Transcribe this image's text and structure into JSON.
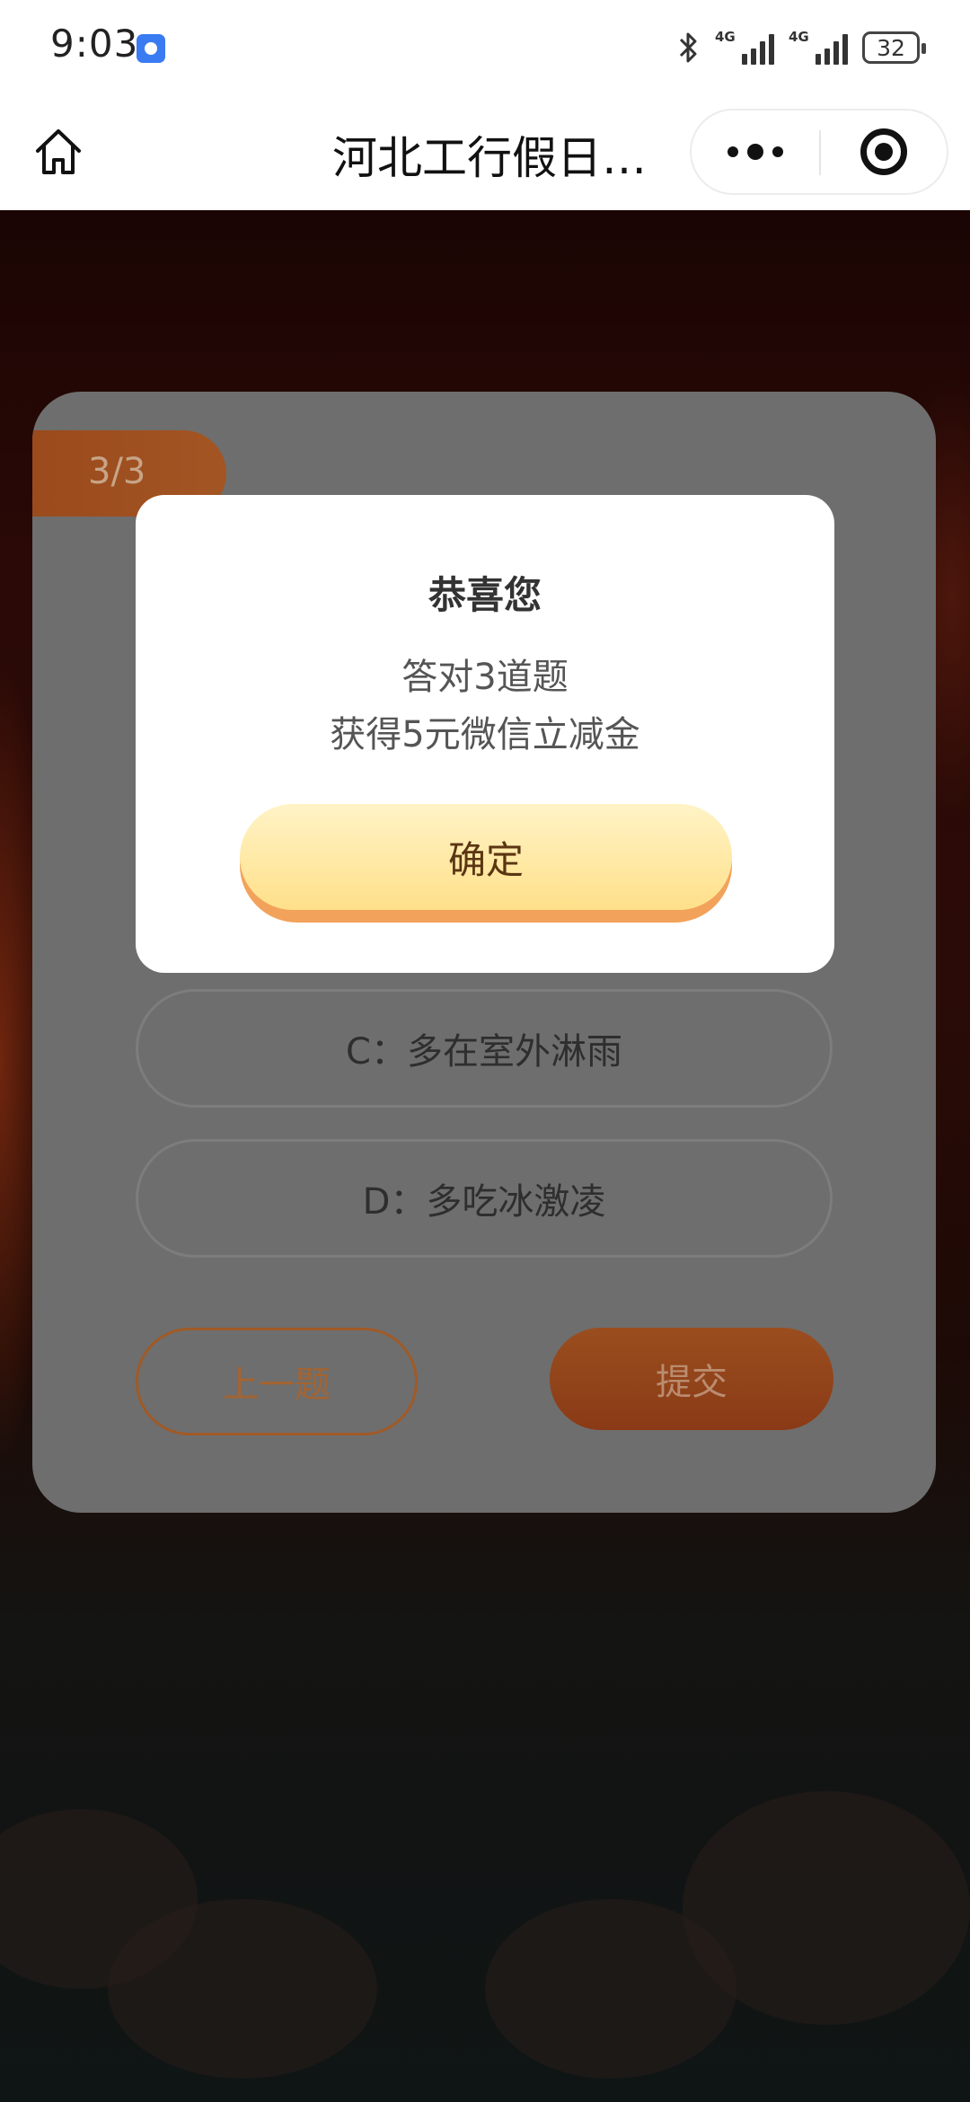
{
  "status_bar": {
    "time": "9:03",
    "network_1": "4G",
    "network_2": "4G",
    "battery": "32",
    "icons": [
      "app-notification-icon",
      "bluetooth-icon",
      "signal-icon",
      "signal-icon",
      "battery-icon"
    ]
  },
  "navbar": {
    "title": "河北工行假日…",
    "icons": [
      "home-icon",
      "more-icon",
      "close-icon"
    ]
  },
  "quiz": {
    "progress": "3/3",
    "options": [
      {
        "label": "C：多在室外淋雨"
      },
      {
        "label": "D：多吃冰激凌"
      }
    ],
    "prev_label": "上一题",
    "submit_label": "提交"
  },
  "modal": {
    "title": "恭喜您",
    "line1": "答对3道题",
    "line2": "获得5元微信立减金",
    "confirm_label": "确定"
  },
  "colors": {
    "accent_orange": "#a35523",
    "button_gold": "#ffe08a",
    "overlay_card": "#6e6e6e"
  }
}
